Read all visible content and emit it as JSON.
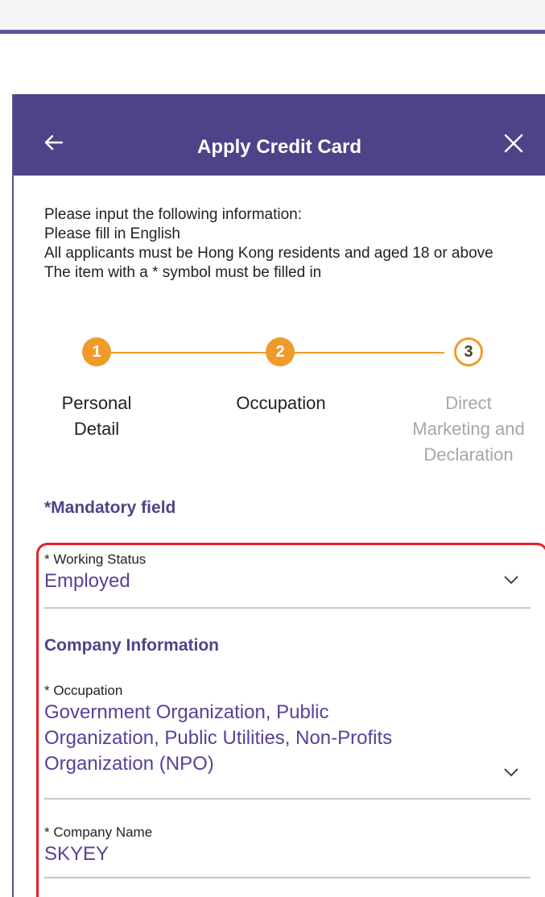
{
  "header": {
    "title": "Apply Credit Card",
    "back_icon": "arrow-left-icon",
    "close_icon": "close-icon"
  },
  "intro": {
    "lines": [
      "Please input the following information:",
      "Please fill in English",
      "All applicants must be Hong Kong residents and aged 18 or above",
      "The item with a * symbol must be filled in"
    ]
  },
  "steps": [
    {
      "number": "1",
      "label_lines": [
        "Personal",
        "Detail"
      ],
      "state": "done"
    },
    {
      "number": "2",
      "label_lines": [
        "Occupation"
      ],
      "state": "current"
    },
    {
      "number": "3",
      "label_lines": [
        "Direct",
        "Marketing and",
        "Declaration"
      ],
      "state": "todo"
    }
  ],
  "mandatory_note": "*Mandatory field",
  "form": {
    "working_status": {
      "label": "* Working Status",
      "value": "Employed"
    },
    "company_section": "Company Information",
    "occupation": {
      "label": "* Occupation",
      "value_lines": [
        "Government Organization, Public",
        "Organization, Public Utilities, Non-Profits",
        "Organization (NPO)"
      ]
    },
    "company_name": {
      "label": "* Company Name",
      "value": "SKYEY"
    }
  },
  "colors": {
    "brand_purple": "#4e4388",
    "value_purple": "#5a3f98",
    "step_orange": "#ef9b2a",
    "highlight_red": "#e4232a"
  }
}
